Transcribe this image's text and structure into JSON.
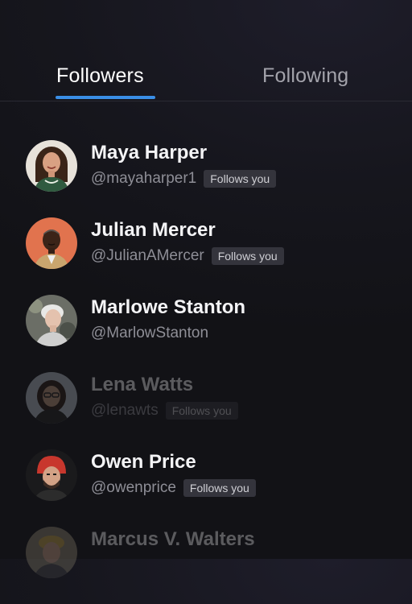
{
  "tabs": {
    "followers": "Followers",
    "following": "Following"
  },
  "users": [
    {
      "name": "Maya Harper",
      "handle": "@mayaharper1",
      "badge": "Follows you"
    },
    {
      "name": "Julian Mercer",
      "handle": "@JulianAMercer",
      "badge": "Follows you"
    },
    {
      "name": "Marlowe Stanton",
      "handle": "@MarlowStanton"
    },
    {
      "name": "Lena Watts",
      "handle": "@lenawts",
      "badge": "Follows you"
    },
    {
      "name": "Owen Price",
      "handle": "@owenprice",
      "badge": "Follows you"
    },
    {
      "name": "Marcus V. Walters"
    }
  ],
  "colors": {
    "accent": "#3a8ee6",
    "background": "#16161d",
    "badge_bg": "#34343c"
  }
}
